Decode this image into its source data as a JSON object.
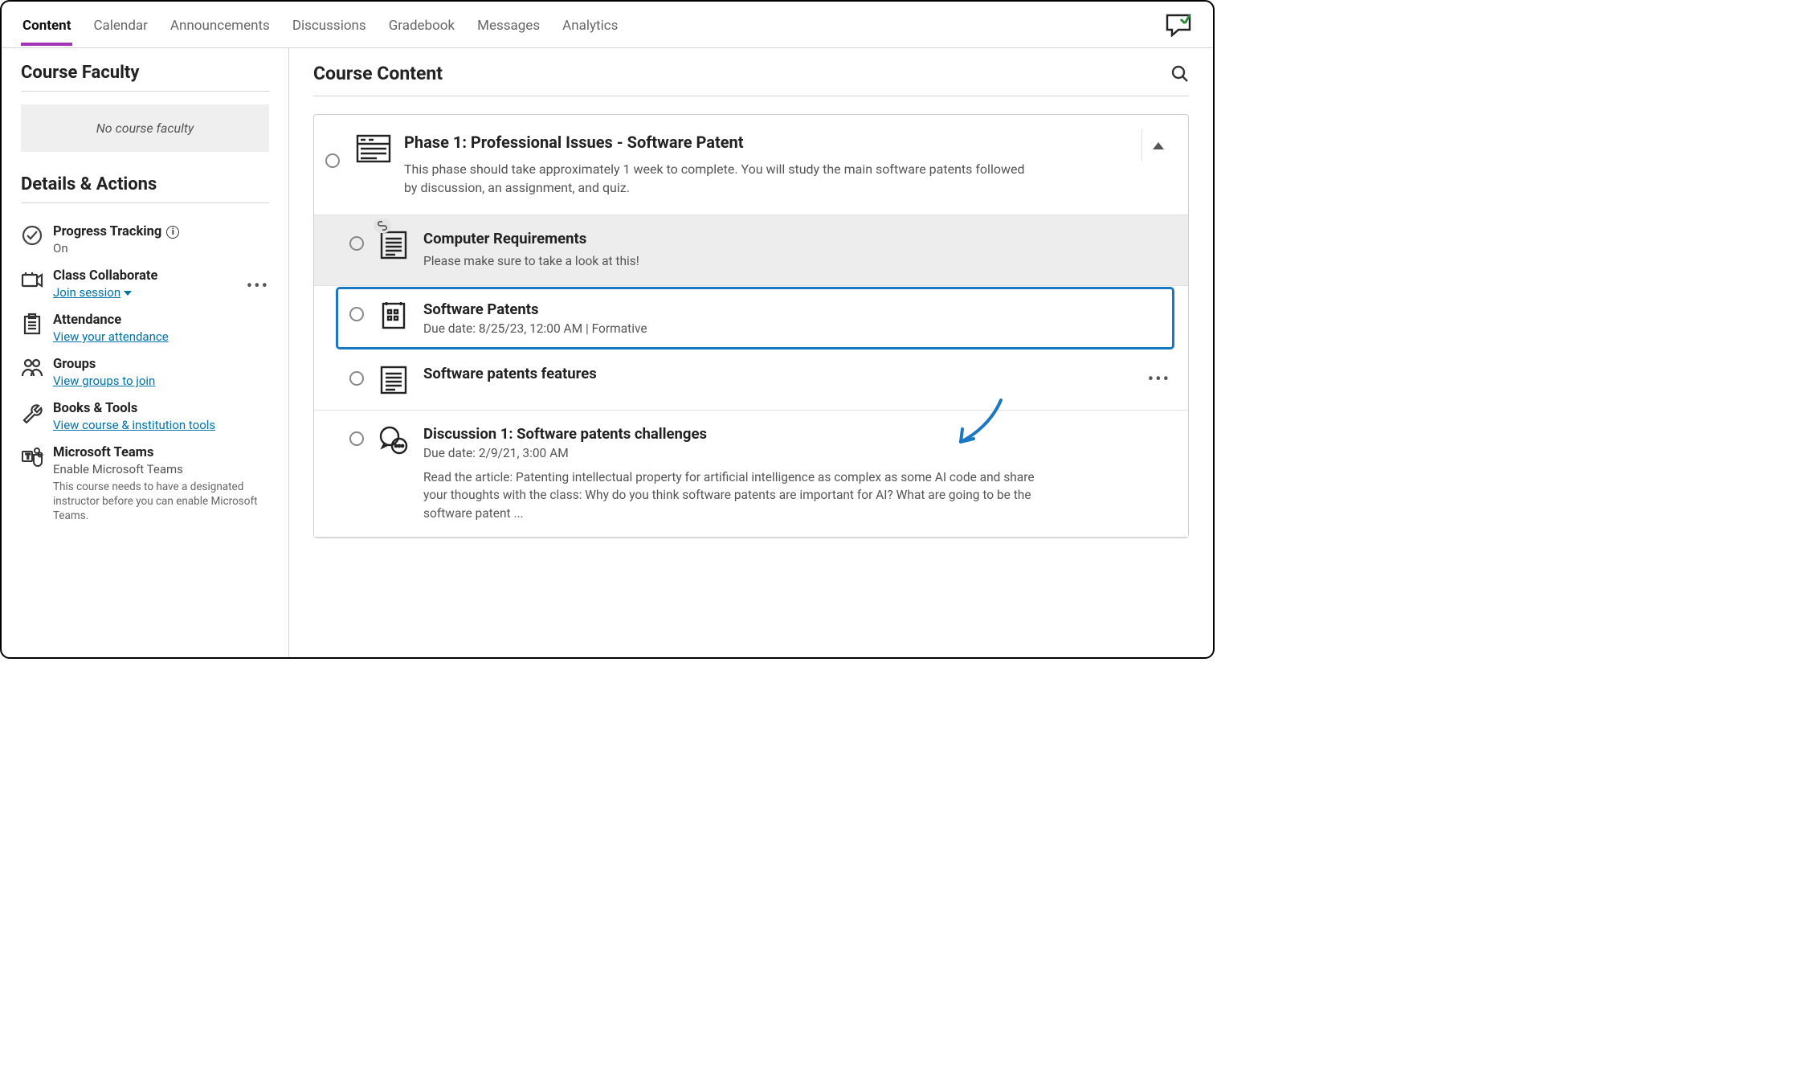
{
  "nav": {
    "tabs": [
      "Content",
      "Calendar",
      "Announcements",
      "Discussions",
      "Gradebook",
      "Messages",
      "Analytics"
    ],
    "active": 0
  },
  "sidebar": {
    "faculty_heading": "Course Faculty",
    "faculty_empty": "No course faculty",
    "da_heading": "Details & Actions",
    "items": [
      {
        "title": "Progress Tracking",
        "sub": "On",
        "info_icon": true
      },
      {
        "title": "Class Collaborate",
        "link": "Join session",
        "menu": true,
        "dropdown": true
      },
      {
        "title": "Attendance",
        "link": "View your attendance"
      },
      {
        "title": "Groups",
        "link": "View groups to join"
      },
      {
        "title": "Books & Tools",
        "link": "View course & institution tools"
      },
      {
        "title": "Microsoft Teams",
        "sub": "Enable Microsoft Teams",
        "info": "This course needs to have a designated instructor before you can enable Microsoft Teams."
      }
    ]
  },
  "main": {
    "heading": "Course Content",
    "module": {
      "title": "Phase 1: Professional Issues - Software Patent",
      "desc": "This phase should take approximately 1 week to complete. You will study the main software patents followed by discussion, an assignment, and quiz."
    },
    "items": [
      {
        "title": "Computer Requirements",
        "desc": "Please make sure to take a look at this!",
        "shaded": true,
        "link_badge": true,
        "icon": "doc"
      },
      {
        "title": "Software Patents",
        "meta": "Due date: 8/25/23, 12:00 AM | Formative",
        "highlighted": true,
        "icon": "assessment"
      },
      {
        "title": "Software patents features",
        "icon": "doc",
        "menu": true
      },
      {
        "title": "Discussion 1: Software patents challenges",
        "meta": "Due date: 2/9/21, 3:00 AM",
        "desc": "Read the article: Patenting intellectual property for artificial intelligence as complex as some AI code and share your thoughts with the class: Why do you think software patents are important for AI? What are going to be the software patent ...",
        "icon": "discussion"
      }
    ]
  }
}
